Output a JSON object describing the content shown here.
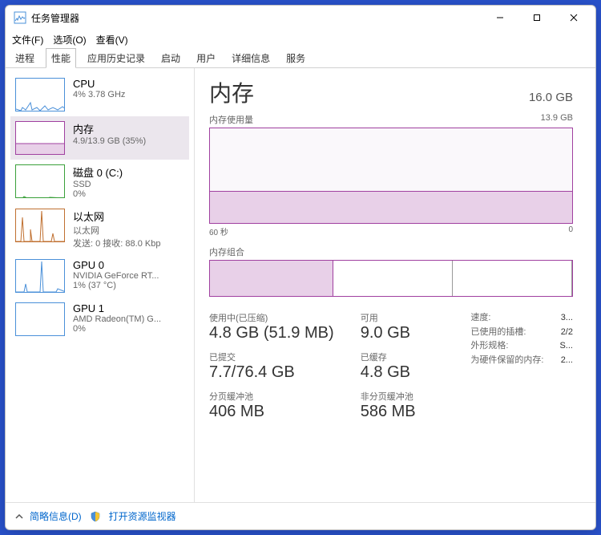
{
  "window": {
    "title": "任务管理器"
  },
  "win_controls": {
    "min": "—",
    "max": "▢",
    "close": "✕"
  },
  "menubar": [
    {
      "label": "文件(F)"
    },
    {
      "label": "选项(O)"
    },
    {
      "label": "查看(V)"
    }
  ],
  "tabs": [
    {
      "label": "进程",
      "active": false
    },
    {
      "label": "性能",
      "active": true
    },
    {
      "label": "应用历史记录",
      "active": false
    },
    {
      "label": "启动",
      "active": false
    },
    {
      "label": "用户",
      "active": false
    },
    {
      "label": "详细信息",
      "active": false
    },
    {
      "label": "服务",
      "active": false
    }
  ],
  "sidebar": [
    {
      "id": "cpu",
      "title": "CPU",
      "sub": "4%  3.78 GHz",
      "color": "#4a90d9",
      "active": false
    },
    {
      "id": "memory",
      "title": "内存",
      "sub": "4.9/13.9 GB (35%)",
      "color": "#a040a0",
      "active": true
    },
    {
      "id": "disk",
      "title": "磁盘 0 (C:)",
      "sub": "SSD",
      "sub2": "0%",
      "color": "#3aa03a",
      "active": false
    },
    {
      "id": "ethernet",
      "title": "以太网",
      "sub": "以太网",
      "sub2": "发送: 0 接收: 88.0 Kbp",
      "color": "#c07030",
      "active": false
    },
    {
      "id": "gpu0",
      "title": "GPU 0",
      "sub": "NVIDIA GeForce RT...",
      "sub2": "1% (37 °C)",
      "color": "#4a90d9",
      "active": false
    },
    {
      "id": "gpu1",
      "title": "GPU 1",
      "sub": "AMD Radeon(TM) G...",
      "sub2": "0%",
      "color": "#4a90d9",
      "active": false
    }
  ],
  "main": {
    "title": "内存",
    "total": "16.0 GB",
    "usage_label": "内存使用量",
    "usage_max": "13.9 GB",
    "x_left": "60 秒",
    "x_right": "0",
    "comp_label": "内存组合",
    "stats": {
      "in_use_label": "使用中(已压缩)",
      "in_use_value": "4.8 GB (51.9 MB)",
      "available_label": "可用",
      "available_value": "9.0 GB",
      "committed_label": "已提交",
      "committed_value": "7.7/76.4 GB",
      "cached_label": "已缓存",
      "cached_value": "4.8 GB",
      "paged_label": "分页缓冲池",
      "paged_value": "406 MB",
      "nonpaged_label": "非分页缓冲池",
      "nonpaged_value": "586 MB"
    },
    "specs": {
      "speed_label": "速度:",
      "speed_value": "3...",
      "slots_label": "已使用的插槽:",
      "slots_value": "2/2",
      "form_label": "外形规格:",
      "form_value": "S...",
      "reserved_label": "为硬件保留的内存:",
      "reserved_value": "2..."
    }
  },
  "footer": {
    "brief": "简略信息(D)",
    "resmon": "打开资源监视器"
  },
  "chart_data": {
    "type": "area",
    "title": "内存使用量",
    "xlabel": "60 秒 → 0",
    "ylabel": "GB",
    "ylim": [
      0,
      13.9
    ],
    "x": [
      60,
      55,
      50,
      45,
      40,
      35,
      30,
      25,
      20,
      15,
      10,
      5,
      0
    ],
    "values": [
      4.8,
      4.8,
      4.8,
      4.8,
      4.8,
      4.8,
      4.8,
      4.8,
      4.8,
      4.8,
      4.8,
      4.8,
      4.8
    ]
  }
}
